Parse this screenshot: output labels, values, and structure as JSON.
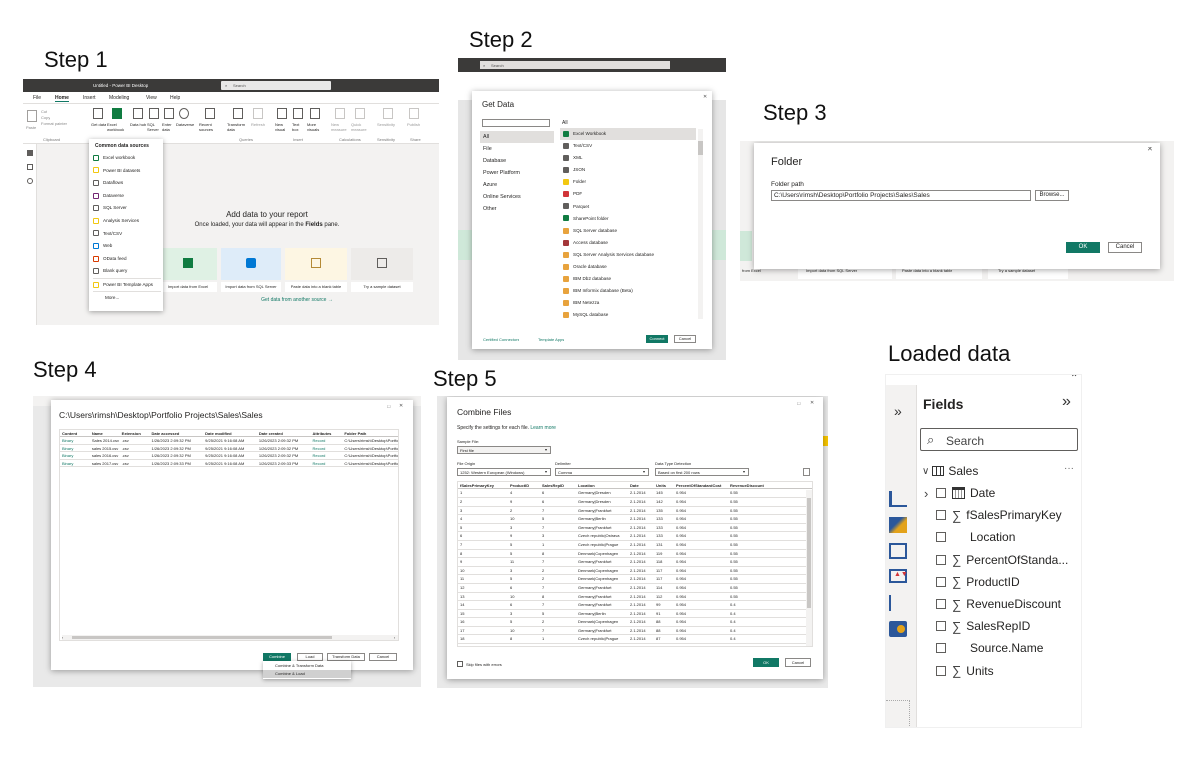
{
  "steps": {
    "s1": "Step 1",
    "s2": "Step 2",
    "s3": "Step 3",
    "s4": "Step 4",
    "s5": "Step 5",
    "loaded": "Loaded data"
  },
  "step1": {
    "window_title": "Untitled - Power BI Desktop",
    "search": "Search",
    "menu": [
      "File",
      "Home",
      "Insert",
      "Modeling",
      "View",
      "Help"
    ],
    "ribbon": [
      "Get data",
      "Excel workbook",
      "Data hub",
      "SQL Server",
      "Enter data",
      "Dataverse",
      "Recent sources",
      "Transform data",
      "Refresh",
      "New visual",
      "Text box",
      "More visuals",
      "New measure",
      "Quick measure",
      "Sensitivity",
      "Publish"
    ],
    "groups": [
      "Clipboard",
      "Queries",
      "Insert",
      "Calculations",
      "Sensitivity",
      "Share"
    ],
    "clipboard": [
      "Paste",
      "Cut",
      "Copy",
      "Format painter"
    ],
    "dropdown_header": "Common data sources",
    "dropdown": [
      "Excel workbook",
      "Power BI datasets",
      "Dataflows",
      "Dataverse",
      "SQL Server",
      "Analysis Services",
      "Text/CSV",
      "Web",
      "OData feed",
      "Blank query",
      "Power BI Template Apps",
      "More..."
    ],
    "add_title": "Add data to your report",
    "add_sub_pre": "Once loaded, your data will appear in the ",
    "add_sub_bold": "Fields",
    "add_sub_post": " pane.",
    "cards": [
      "Import data from Excel",
      "Import data from SQL Server",
      "Paste data into a blank table",
      "Try a sample dataset"
    ],
    "another": "Get data from another source →"
  },
  "step2": {
    "search": "Search",
    "title": "Get Data",
    "categories": [
      "All",
      "File",
      "Database",
      "Power Platform",
      "Azure",
      "Online Services",
      "Other"
    ],
    "list_header": "All",
    "items": [
      "Excel Workbook",
      "Text/CSV",
      "XML",
      "JSON",
      "Folder",
      "PDF",
      "Parquet",
      "SharePoint folder",
      "SQL Server database",
      "Access database",
      "SQL Server Analysis Services database",
      "Oracle database",
      "IBM Db2 database",
      "IBM Informix database (Beta)",
      "IBM Netezza",
      "MySQL database"
    ],
    "certified": "Certified Connectors",
    "template": "Template Apps",
    "connect": "Connect",
    "cancel": "Cancel"
  },
  "step3": {
    "title": "Folder",
    "label": "Folder path",
    "path": "C:\\Users\\rimsh\\Desktop\\Portfolio Projects\\Sales\\Sales",
    "browse": "Browse...",
    "ok": "OK",
    "cancel": "Cancel",
    "bg": [
      "from Excel",
      "Import data from SQL Server",
      "Paste data into a blank table",
      "Try a sample dataset"
    ]
  },
  "step4": {
    "title": "C:\\Users\\rimsh\\Desktop\\Portfolio Projects\\Sales\\Sales",
    "columns": [
      "Content",
      "Name",
      "Extension",
      "Date accessed",
      "Date modified",
      "Date created",
      "Attributes",
      "Folder Path"
    ],
    "rows": [
      [
        "Binary",
        "Sales 2014.csv",
        ".csv",
        "1/26/2023 2:09:32 PM",
        "9/25/2021 9:16:08 AM",
        "1/26/2023 2:09:32 PM",
        "Record",
        "C:\\Users\\rimsh\\Desktop\\Portfolio"
      ],
      [
        "Binary",
        "sales 2015.csv",
        ".csv",
        "1/26/2023 2:09:32 PM",
        "9/25/2021 9:16:08 AM",
        "1/26/2023 2:09:32 PM",
        "Record",
        "C:\\Users\\rimsh\\Desktop\\Portfolio"
      ],
      [
        "Binary",
        "sales 2016.csv",
        ".csv",
        "1/26/2023 2:09:32 PM",
        "9/25/2021 9:16:08 AM",
        "1/26/2023 2:09:32 PM",
        "Record",
        "C:\\Users\\rimsh\\Desktop\\Portfolio"
      ],
      [
        "Binary",
        "sales 2017.csv",
        ".csv",
        "1/26/2023 2:09:33 PM",
        "9/25/2021 9:16:08 AM",
        "1/26/2023 2:09:33 PM",
        "Record",
        "C:\\Users\\rimsh\\Desktop\\Portfolio"
      ]
    ],
    "combine": "Combine",
    "load": "Load",
    "transform": "Transform Data",
    "cancel": "Cancel",
    "menu": [
      "Combine & Transform Data",
      "Combine & Load"
    ]
  },
  "step5": {
    "title": "Combine Files",
    "desc": "Specify the settings for each file.",
    "learn": "Learn more",
    "sample_label": "Sample File:",
    "sample_value": "First file",
    "origin_label": "File Origin",
    "origin_value": "1252: Western European (Windows)",
    "delim_label": "Delimiter",
    "delim_value": "Comma",
    "detect_label": "Data Type Detection",
    "detect_value": "Based on first 200 rows",
    "columns": [
      "fSalesPrimaryKey",
      "ProductID",
      "SalesRepID",
      "Location",
      "Date",
      "Units",
      "PercentOfStandardCost",
      "RevenueDiscount"
    ],
    "rows": [
      [
        "1",
        "4",
        "6",
        "Germany|Dresden",
        "2.1.2014",
        "145",
        "0.954",
        "0.55"
      ],
      [
        "2",
        "9",
        "6",
        "Germany|Dresden",
        "2.1.2014",
        "142",
        "0.954",
        "0.55"
      ],
      [
        "3",
        "2",
        "7",
        "Germany|Frankfurt",
        "2.1.2014",
        "135",
        "0.954",
        "0.55"
      ],
      [
        "4",
        "10",
        "5",
        "Germany|Berlin",
        "2.1.2014",
        "133",
        "0.954",
        "0.55"
      ],
      [
        "5",
        "3",
        "7",
        "Germany|Frankfurt",
        "2.1.2014",
        "133",
        "0.954",
        "0.55"
      ],
      [
        "6",
        "9",
        "3",
        "Czech republic|Ostrava",
        "2.1.2014",
        "133",
        "0.954",
        "0.55"
      ],
      [
        "7",
        "5",
        "1",
        "Czech republic|Prague",
        "2.1.2014",
        "131",
        "0.954",
        "0.55"
      ],
      [
        "8",
        "5",
        "8",
        "Denmark|Copenhagen",
        "2.1.2014",
        "119",
        "0.954",
        "0.55"
      ],
      [
        "9",
        "11",
        "7",
        "Germany|Frankfurt",
        "2.1.2014",
        "118",
        "0.954",
        "0.55"
      ],
      [
        "10",
        "3",
        "2",
        "Denmark|Copenhagen",
        "2.1.2014",
        "117",
        "0.954",
        "0.55"
      ],
      [
        "11",
        "5",
        "2",
        "Denmark|Copenhagen",
        "2.1.2014",
        "117",
        "0.954",
        "0.55"
      ],
      [
        "12",
        "6",
        "7",
        "Germany|Frankfurt",
        "2.1.2014",
        "114",
        "0.954",
        "0.55"
      ],
      [
        "13",
        "10",
        "8",
        "Germany|Frankfurt",
        "2.1.2014",
        "112",
        "0.954",
        "0.55"
      ],
      [
        "14",
        "6",
        "7",
        "Germany|Frankfurt",
        "2.1.2014",
        "99",
        "0.954",
        "0.4"
      ],
      [
        "15",
        "3",
        "5",
        "Germany|Berlin",
        "2.1.2014",
        "91",
        "0.954",
        "0.4"
      ],
      [
        "16",
        "5",
        "2",
        "Denmark|Copenhagen",
        "2.1.2014",
        "88",
        "0.954",
        "0.4"
      ],
      [
        "17",
        "10",
        "7",
        "Germany|Frankfurt",
        "2.1.2014",
        "88",
        "0.954",
        "0.4"
      ],
      [
        "18",
        "8",
        "1",
        "Czech republic|Prague",
        "2.1.2014",
        "87",
        "0.954",
        "0.4"
      ]
    ],
    "skip": "Skip files with errors",
    "ok": "OK",
    "cancel": "Cancel"
  },
  "fields": {
    "title": "Fields",
    "search": "Search",
    "table": "Sales",
    "more": "···",
    "items": [
      {
        "label": "Date",
        "kind": "date"
      },
      {
        "label": "fSalesPrimaryKey",
        "kind": "sum"
      },
      {
        "label": "Location",
        "kind": "text"
      },
      {
        "label": "PercentOfStanda...",
        "kind": "sum"
      },
      {
        "label": "ProductID",
        "kind": "sum"
      },
      {
        "label": "RevenueDiscount",
        "kind": "sum"
      },
      {
        "label": "SalesRepID",
        "kind": "sum"
      },
      {
        "label": "Source.Name",
        "kind": "text"
      },
      {
        "label": "Units",
        "kind": "sum"
      }
    ]
  }
}
